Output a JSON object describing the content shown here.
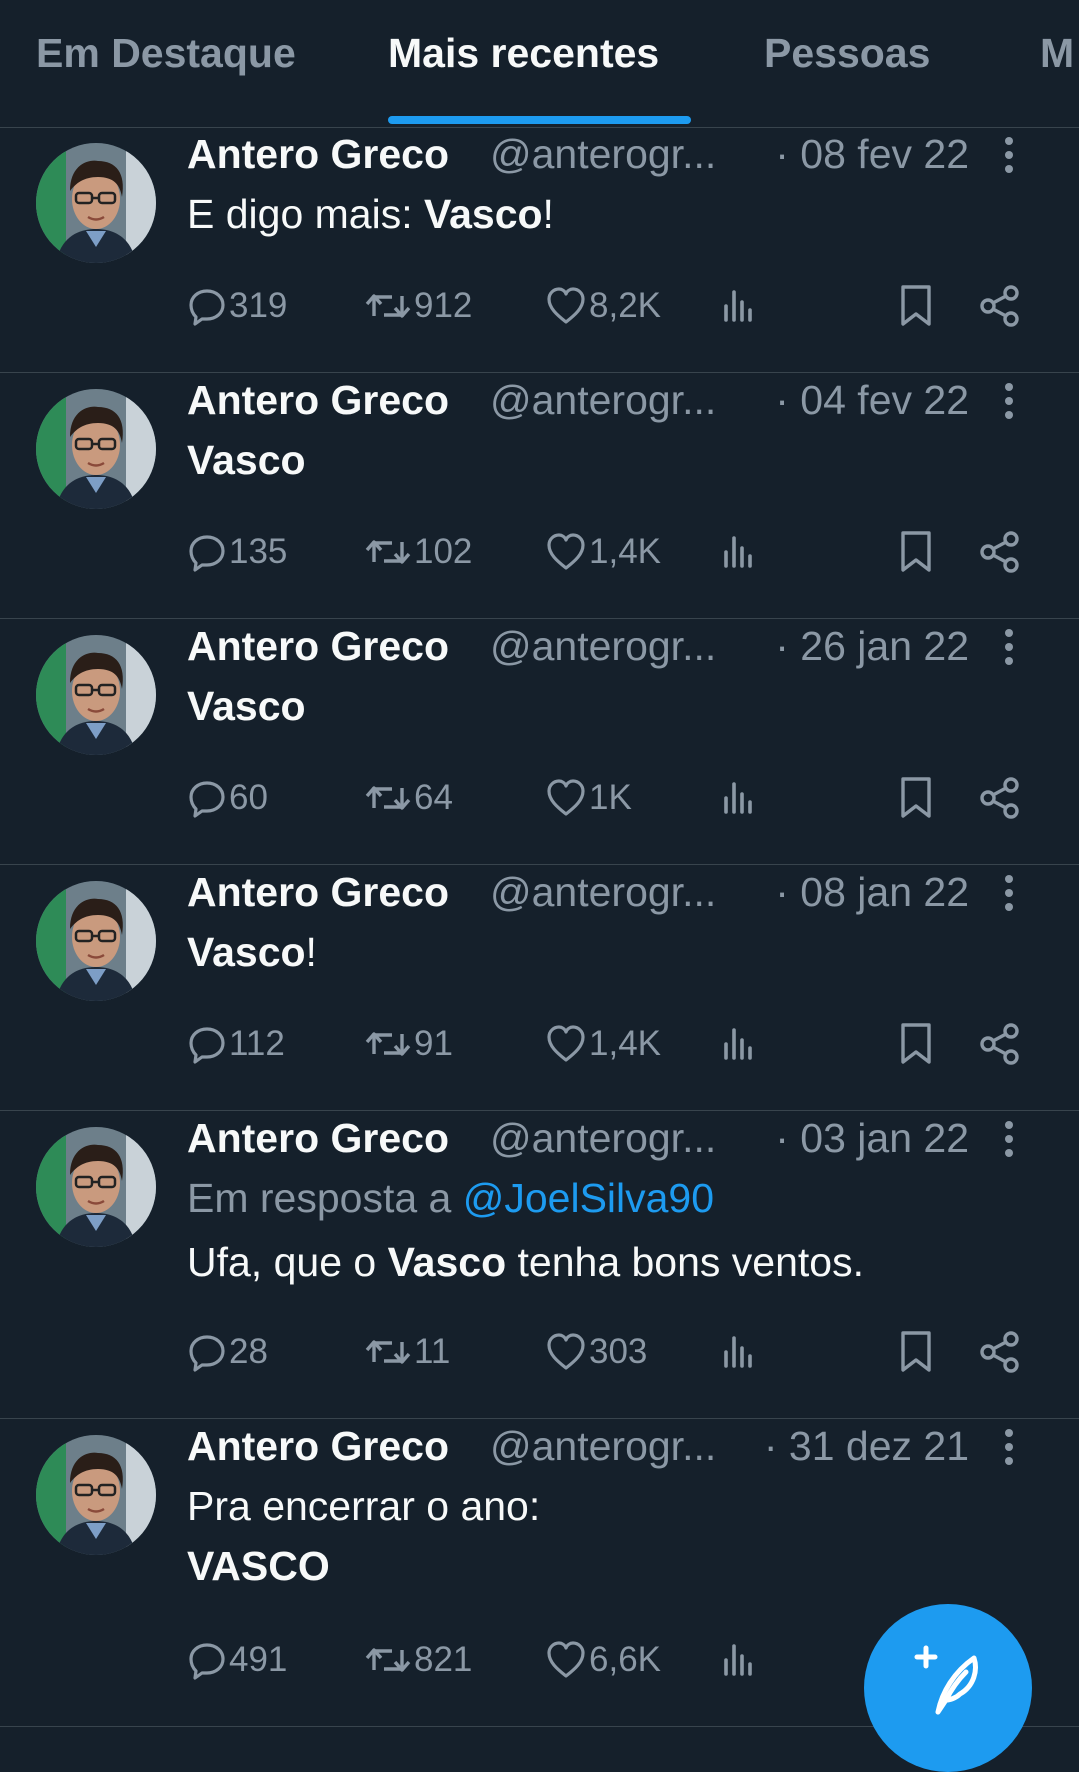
{
  "tabs": [
    {
      "label": "Em Destaque"
    },
    {
      "label": "Mais recentes"
    },
    {
      "label": "Pessoas"
    },
    {
      "label": "M"
    }
  ],
  "tweets": [
    {
      "name": "Antero Greco",
      "handle": "@anterogr...",
      "date": "· 08 fev 22",
      "lines": [
        [
          {
            "t": "E digo mais: "
          },
          {
            "t": "Vasco",
            "b": true
          },
          {
            "t": "!"
          }
        ]
      ],
      "replies": "319",
      "retweets": "912",
      "likes": "8,2K"
    },
    {
      "name": "Antero Greco",
      "handle": "@anterogr...",
      "date": "· 04 fev 22",
      "lines": [
        [
          {
            "t": "Vasco",
            "b": true
          }
        ]
      ],
      "replies": "135",
      "retweets": "102",
      "likes": "1,4K"
    },
    {
      "name": "Antero Greco",
      "handle": "@anterogr...",
      "date": "· 26 jan 22",
      "lines": [
        [
          {
            "t": "Vasco",
            "b": true
          }
        ]
      ],
      "replies": "60",
      "retweets": "64",
      "likes": "1K"
    },
    {
      "name": "Antero Greco",
      "handle": "@anterogr...",
      "date": "· 08 jan 22",
      "lines": [
        [
          {
            "t": "Vasco",
            "b": true
          },
          {
            "t": "!"
          }
        ]
      ],
      "replies": "112",
      "retweets": "91",
      "likes": "1,4K"
    },
    {
      "name": "Antero Greco",
      "handle": "@anterogr...",
      "date": "· 03 jan 22",
      "reply_prefix": "Em resposta a ",
      "reply_mention": "@JoelSilva90",
      "lines": [
        [
          {
            "t": "Ufa, que o "
          },
          {
            "t": "Vasco",
            "b": true
          },
          {
            "t": " tenha bons ventos."
          }
        ]
      ],
      "replies": "28",
      "retweets": "11",
      "likes": "303"
    },
    {
      "name": "Antero Greco",
      "handle": "@anterogr...",
      "date": "· 31 dez 21",
      "lines": [
        [
          {
            "t": "Pra encerrar o ano:"
          }
        ],
        [
          {
            "t": "VASCO",
            "b": true
          }
        ]
      ],
      "replies": "491",
      "retweets": "821",
      "likes": "6,6K"
    }
  ],
  "icons": {
    "reply": "reply-icon",
    "retweet": "retweet-icon",
    "like": "heart-icon",
    "views": "views-icon",
    "bookmark": "bookmark-icon",
    "share": "share-icon",
    "more": "more-icon",
    "compose": "compose-tweet-icon"
  },
  "colors": {
    "background": "#15202b",
    "text": "#f7f9f9",
    "muted": "#8b98a5",
    "accent": "#1d9bf0",
    "divider": "#38444d"
  }
}
